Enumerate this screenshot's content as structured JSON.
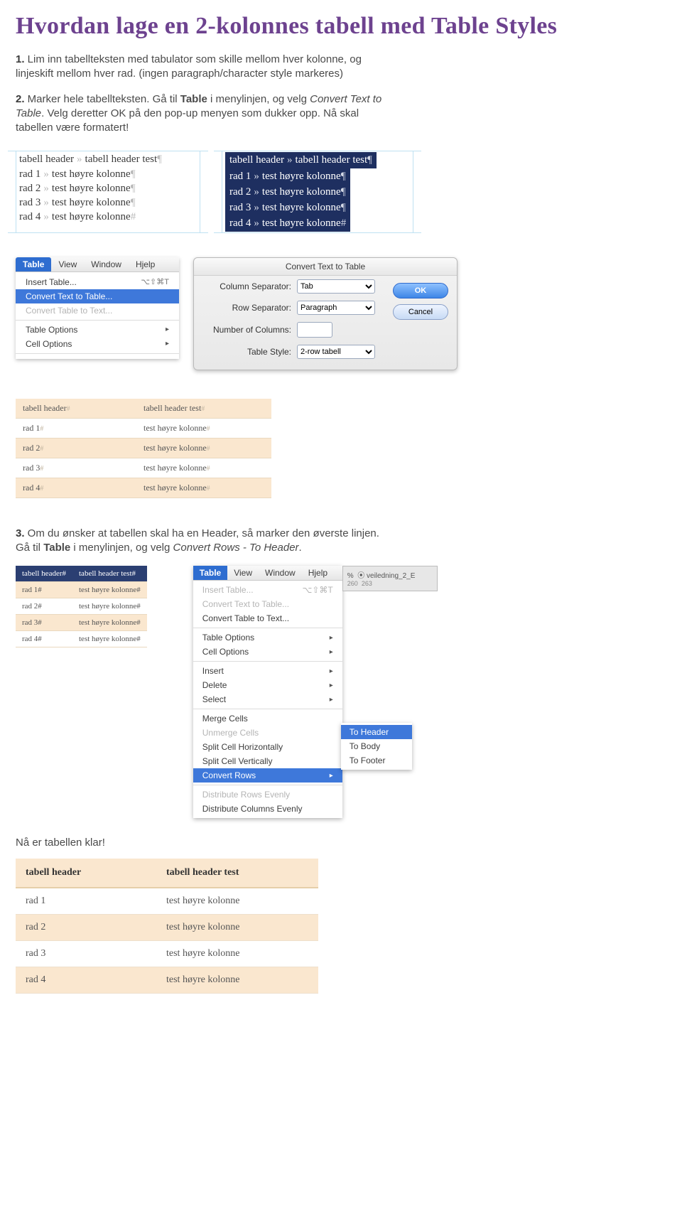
{
  "title": "Hvordan lage en 2-kolonnes tabell med Table Styles",
  "p1a": "1.",
  "p1b": " Lim inn tabellteksten med tabulator som skille mellom hver kolonne, og linjeskift mellom hver rad. (ingen paragraph/character style markeres)",
  "p2a": "2.",
  "p2b": " Marker hele tabellteksten. Gå til ",
  "p2c": "Table",
  "p2d": " i menylinjen, og velg ",
  "p2e": "Convert Text to Table",
  "p2f": ". Velg deretter OK på den pop-up menyen som dukker opp. Nå skal tabellen være formatert!",
  "sample_rows": [
    [
      "tabell header",
      "tabell header test"
    ],
    [
      "rad 1",
      "test høyre kolonne"
    ],
    [
      "rad 2",
      "test høyre kolonne"
    ],
    [
      "rad 3",
      "test høyre kolonne"
    ],
    [
      "rad 4",
      "test høyre kolonne"
    ]
  ],
  "menu": {
    "head": [
      "Table",
      "View",
      "Window",
      "Hjelp"
    ],
    "items": [
      {
        "label": "Insert Table...",
        "shortcut": "⌥⇧⌘T"
      },
      {
        "label": "Convert Text to Table...",
        "selected": true
      },
      {
        "label": "Convert Table to Text...",
        "disabled": true
      },
      {
        "sep": true
      },
      {
        "label": "Table Options",
        "sub": true
      },
      {
        "label": "Cell Options",
        "sub": true
      },
      {
        "sep": true
      }
    ]
  },
  "dialog": {
    "title": "Convert Text to Table",
    "colsep_label": "Column Separator:",
    "colsep_value": "Tab",
    "rowsep_label": "Row Separator:",
    "rowsep_value": "Paragraph",
    "numcol_label": "Number of Columns:",
    "style_label": "Table Style:",
    "style_value": "2-row tabell",
    "ok": "OK",
    "cancel": "Cancel"
  },
  "p3a": "3.",
  "p3b": " Om du ønsker at tabellen skal ha en Header, så marker den øverste linjen. Gå til ",
  "p3c": "Table",
  "p3d": " i menylinjen, og velg ",
  "p3e": "Convert Rows - To Header",
  "p3f": ".",
  "ctx": {
    "head": [
      "Table",
      "View",
      "Window",
      "Hjelp"
    ],
    "items": [
      {
        "label": "Insert Table...",
        "shortcut": "⌥⇧⌘T",
        "disabled": true
      },
      {
        "label": "Convert Text to Table...",
        "disabled": true
      },
      {
        "label": "Convert Table to Text..."
      },
      {
        "sep": true
      },
      {
        "label": "Table Options",
        "sub": true
      },
      {
        "label": "Cell Options",
        "sub": true
      },
      {
        "sep": true
      },
      {
        "label": "Insert",
        "sub": true
      },
      {
        "label": "Delete",
        "sub": true
      },
      {
        "label": "Select",
        "sub": true
      },
      {
        "sep": true
      },
      {
        "label": "Merge Cells"
      },
      {
        "label": "Unmerge Cells",
        "disabled": true
      },
      {
        "label": "Split Cell Horizontally"
      },
      {
        "label": "Split Cell Vertically"
      },
      {
        "label": "Convert Rows",
        "sub": true,
        "selected": true
      },
      {
        "sep": true
      },
      {
        "label": "Distribute Rows Evenly",
        "disabled": true
      },
      {
        "label": "Distribute Columns Evenly"
      }
    ],
    "submenu": [
      "To Header",
      "To Body",
      "To Footer"
    ]
  },
  "panel": {
    "pct": "%",
    "file": "veiledning_2_E",
    "a": "260",
    "b": "263"
  },
  "done": "Nå er tabellen klar!"
}
